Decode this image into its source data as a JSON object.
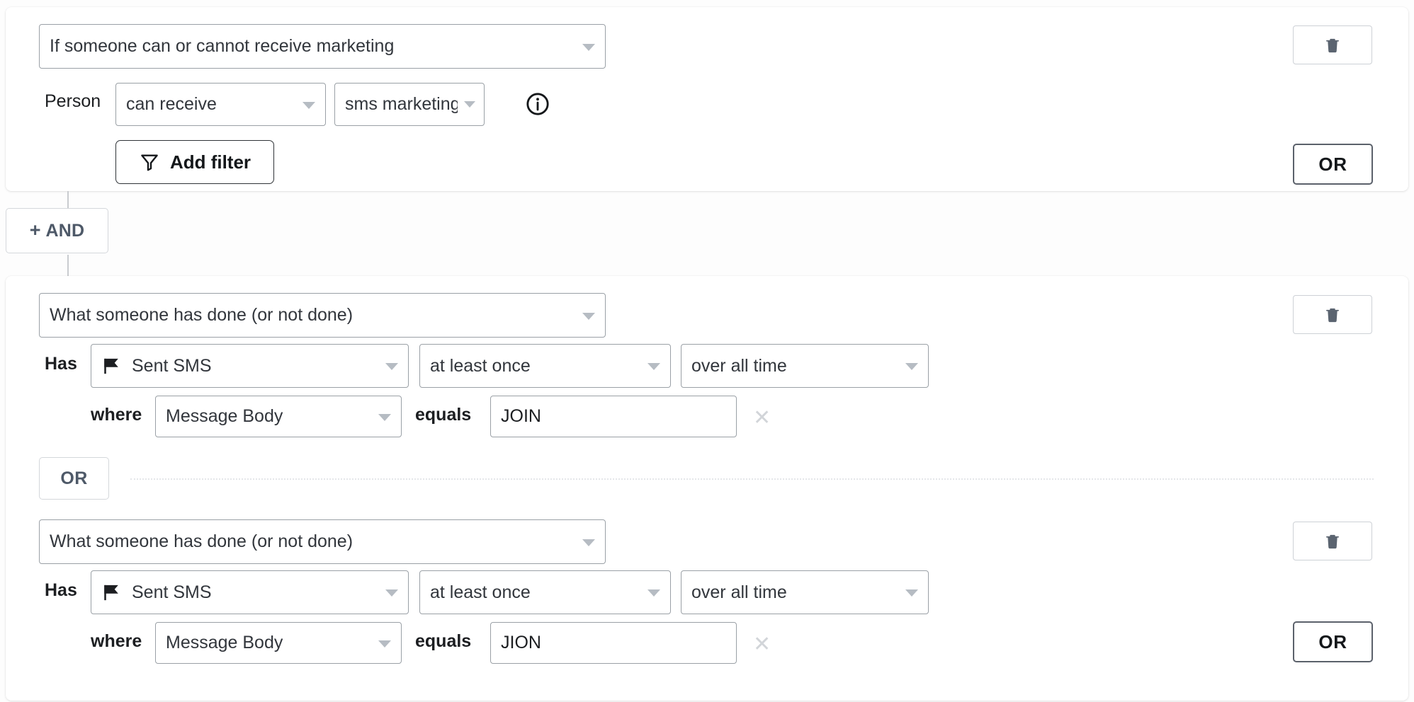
{
  "theme": {
    "card_bg": "#ffffff",
    "page_bg": "#fdfdfd",
    "border": "#9aa0a6",
    "accent_dark": "#14171a",
    "muted": "#4e5968",
    "caret": "#b6bcc3",
    "dotted": "#e4e6e9"
  },
  "connector": {
    "and_button_label": "AND",
    "and_button_plus": "+"
  },
  "blocks": [
    {
      "id": "block-1",
      "type_select": {
        "value": "If someone can or cannot receive marketing",
        "icon": "chevron-down-icon"
      },
      "rows": [
        {
          "prefix": "Person",
          "selects": [
            {
              "value": "can receive",
              "icon": "chevron-down-icon"
            },
            {
              "value": "sms marketing",
              "icon": "chevron-down-icon"
            }
          ],
          "info_icon": "info-circle-icon"
        }
      ],
      "add_filter": {
        "label": "Add filter",
        "icon": "filter-funnel-icon"
      },
      "delete_button": {
        "icon": "trash-icon"
      },
      "or_button": {
        "label": "OR"
      }
    },
    {
      "id": "block-2",
      "conditions": [
        {
          "type_select": {
            "value": "What someone has done (or not done)",
            "icon": "chevron-down-icon"
          },
          "has_prefix": "Has",
          "metric_select": {
            "value": "Sent SMS",
            "icon": "sms-flag-icon",
            "caret": "chevron-down-icon"
          },
          "frequency_select": {
            "value": "at least once",
            "icon": "chevron-down-icon"
          },
          "timeframe_select": {
            "value": "over all time",
            "icon": "chevron-down-icon"
          },
          "filter": {
            "where_label": "where",
            "property_select": {
              "value": "Message Body",
              "icon": "chevron-down-icon"
            },
            "operator_label": "equals",
            "value_input": {
              "value": "JOIN",
              "placeholder": ""
            },
            "clear_icon": "close-x-icon"
          },
          "delete_button": {
            "icon": "trash-icon"
          }
        },
        {
          "type_select": {
            "value": "What someone has done (or not done)",
            "icon": "chevron-down-icon"
          },
          "has_prefix": "Has",
          "metric_select": {
            "value": "Sent SMS",
            "icon": "sms-flag-icon",
            "caret": "chevron-down-icon"
          },
          "frequency_select": {
            "value": "at least once",
            "icon": "chevron-down-icon"
          },
          "timeframe_select": {
            "value": "over all time",
            "icon": "chevron-down-icon"
          },
          "filter": {
            "where_label": "where",
            "property_select": {
              "value": "Message Body",
              "icon": "chevron-down-icon"
            },
            "operator_label": "equals",
            "value_input": {
              "value": "JION",
              "placeholder": ""
            },
            "clear_icon": "close-x-icon"
          },
          "delete_button": {
            "icon": "trash-icon"
          }
        }
      ],
      "or_separator": {
        "label": "OR"
      },
      "or_button": {
        "label": "OR"
      }
    }
  ]
}
